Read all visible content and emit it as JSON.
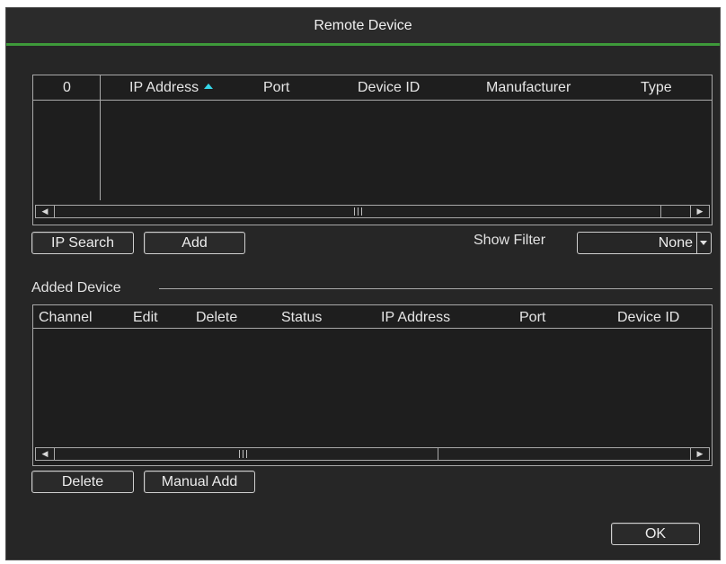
{
  "window": {
    "title": "Remote Device"
  },
  "search_table": {
    "columns": [
      "0",
      "IP Address",
      "Port",
      "Device ID",
      "Manufacturer",
      "Type"
    ],
    "sort_column": "IP Address",
    "sort_direction": "ascending",
    "rows": []
  },
  "search_toolbar": {
    "ip_search_label": "IP Search",
    "add_label": "Add",
    "show_filter_label": "Show Filter",
    "show_filter_value": "None"
  },
  "added_device": {
    "group_label": "Added Device",
    "columns": [
      "Channel",
      "Edit",
      "Delete",
      "Status",
      "IP Address",
      "Port",
      "Device ID"
    ],
    "rows": [],
    "delete_label": "Delete",
    "manual_add_label": "Manual Add"
  },
  "footer": {
    "ok_label": "OK"
  },
  "colors": {
    "window_bg": "#262626",
    "accent_line": "#3e9a3a",
    "sort_arrow": "#35d6e8",
    "border": "#a9a9a9"
  },
  "icons": {
    "sort": "sort-ascending-icon",
    "scroll_left": "arrow-left-icon",
    "scroll_right": "arrow-right-icon",
    "dropdown": "chevron-down-icon"
  }
}
